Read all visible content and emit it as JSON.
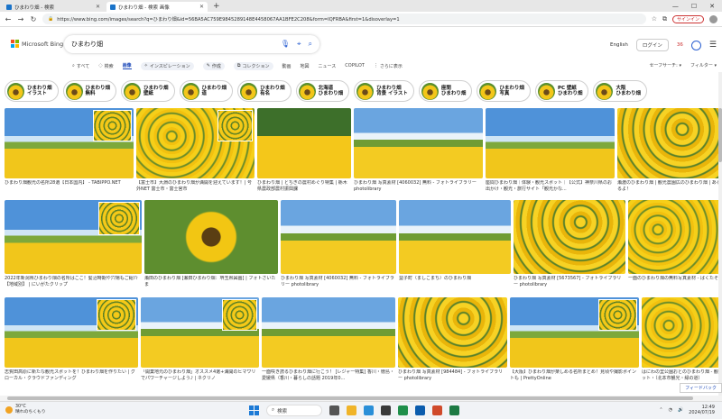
{
  "browser": {
    "tabs": [
      {
        "label": "ひまわり畑 - 検索",
        "active": false
      },
      {
        "label": "ひまわり畑 - 検索 画像",
        "active": true
      }
    ],
    "new_tab": "+",
    "window_buttons": [
      "—",
      "☐",
      "✕"
    ],
    "url": "https://www.bing.com/images/search?q=ひまわり畑&id=56BA5AC759E9845289148E4458067AA1BFE2C208&form=IQFRBA&first=1&disoverlay=1",
    "signin": "サインイン"
  },
  "bing": {
    "logo_text": "Microsoft Bing",
    "query": "ひまわり畑",
    "language": "English",
    "login": "ログイン",
    "points": "36",
    "filters": [
      {
        "label": "すべて",
        "style": ""
      },
      {
        "label": "検索",
        "style": ""
      },
      {
        "label": "画像",
        "style": "sel"
      },
      {
        "label": "インスピレーション",
        "style": "pill"
      },
      {
        "label": "作成",
        "style": "pill"
      },
      {
        "label": "コレクション",
        "style": "pill"
      },
      {
        "label": "動画",
        "style": ""
      },
      {
        "label": "地図",
        "style": ""
      },
      {
        "label": "ニュース",
        "style": ""
      },
      {
        "label": "COPILOT",
        "style": ""
      },
      {
        "label": "さらに表示",
        "style": ""
      }
    ],
    "safe_search": "セーフサーチ:",
    "filter_label": "フィルター"
  },
  "chips": [
    {
      "line1": "ひまわり畑",
      "line2": "イラスト"
    },
    {
      "line1": "ひまわり畑",
      "line2": "無料"
    },
    {
      "line1": "ひまわり畑",
      "line2": "壁紙"
    },
    {
      "line1": "ひまわり畑",
      "line2": "道"
    },
    {
      "line1": "ひまわり畑",
      "line2": "有名"
    },
    {
      "line1": "北海道",
      "line2": "ひまわり畑"
    },
    {
      "line1": "ひまわり畑",
      "line2": "背景 イラスト"
    },
    {
      "line1": "座間",
      "line2": "ひまわり畑"
    },
    {
      "line1": "ひまわり畑",
      "line2": "写真"
    },
    {
      "line1": "PC 壁紙",
      "line2": "ひまわり畑"
    },
    {
      "line1": "大阪",
      "line2": "ひまわり畑"
    }
  ],
  "rows": [
    [
      {
        "caption": "ひまわり畑観光の名所28選【日本国内】 - TABIPPO.NET",
        "style": "sky1",
        "overlay": true
      },
      {
        "caption": "【富士市】大淵のひまわり畑が満開を迎えています！| 号外NET 富士市・富士宮市",
        "style": "field",
        "overlay": true
      },
      {
        "caption": "ひまわり畑 | とちぎの農村めぐり特集 | 栃木県農政部農村振興課",
        "style": "dark",
        "overlay": false
      },
      {
        "caption": "ひまわり畑 写真素材 [4060032] 無料 - フォトライブラリー photolibrary",
        "style": "sky2",
        "overlay": false
      },
      {
        "caption": "座間ひまわり畑｜体験・観光スポット｜【公式】神奈川県のお出かけ・観光・旅行サイト「観光かな...",
        "style": "sky1",
        "overlay": false
      },
      {
        "caption": "瀬渡のひまわり畑 | 観光農園広のひまわり畑 | あるまるよ！",
        "style": "field2",
        "overlay": false
      }
    ],
    [
      {
        "caption": "2022年新潟県ひまわり畑の名所はここ！髪沼時期や穴場もご紹介【地域別】 | にいがたクリップ",
        "style": "sky1",
        "overlay": true
      },
      {
        "caption": "瀬田のひまわり畑 [瀬田ひまわり畑：堺玉県図画] | フォトさいたま",
        "style": "big",
        "overlay": false
      },
      {
        "caption": "ひまわり畑 写真素材 [4060032] 無料 - フォトライブラリー photolibrary",
        "style": "sky2",
        "overlay": false
      },
      {
        "caption": "益子町（ましこまち）のひまわり畑",
        "style": "sky2",
        "overlay": false
      },
      {
        "caption": "ひまわり畑 写真素材 [5673567] - フォトライブラリー photolibrary",
        "style": "field2",
        "overlay": false
      },
      {
        "caption": "一面のひまわり畑の無料写真素材 - ばくたそ",
        "style": "field",
        "overlay": false
      }
    ],
    [
      {
        "caption": "志賀田高原に新たな観光スポットを！ひまわり畑を作りたい | グローカル・クラウドファンディング",
        "style": "sky1",
        "overlay": true
      },
      {
        "caption": "「開業地元のひまわり畑」オススメ4選+満開のヒマワリでパワーチャージしよう♪ | ネクリノ",
        "style": "sky2",
        "overlay": true
      },
      {
        "caption": "一面咲き誇るひまわり畑に行こう！ [レジャー特集] 香川・徳島・愛媛県（香川・暮らしの話題 2019年0...",
        "style": "sky2",
        "overlay": false
      },
      {
        "caption": "ひまわり畑 写真素材 [984484] - フォトライブラリー photolibrary",
        "style": "field2",
        "overlay": false
      },
      {
        "caption": "【大阪】ひまわり畑が楽しめる名所まとめ！見頃や撮影ポイントも | PrettyOnline",
        "style": "sky1",
        "overlay": true
      },
      {
        "caption": "はにわの里公園おとのひまわり畑 - 観光スポット・（北本市観光・緑の道）",
        "style": "field",
        "overlay": false
      }
    ]
  ],
  "feedback": "フィードバック",
  "taskbar": {
    "temp": "30°C",
    "weather": "晴れのちくもり",
    "search": "検索",
    "time": "12:49",
    "date": "2024/07/19"
  }
}
